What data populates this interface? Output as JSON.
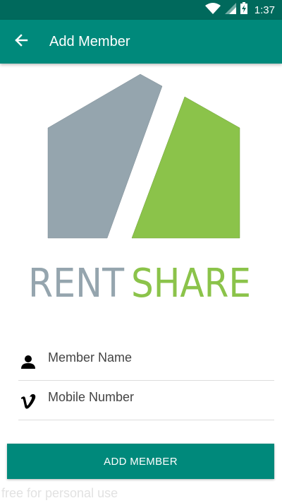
{
  "status_bar": {
    "time": "1:37",
    "icons": [
      "wifi-icon",
      "cell-signal-icon",
      "battery-charging-icon"
    ]
  },
  "app_bar": {
    "title": "Add Member",
    "back_icon": "arrow-left-icon"
  },
  "logo": {
    "word1": "RENT",
    "word2": "SHARE",
    "color_gray": "#95A5AE",
    "color_green": "#8BC34A"
  },
  "form": {
    "member_name": {
      "placeholder": "Member Name",
      "value": "",
      "icon": "person-icon"
    },
    "mobile_number": {
      "placeholder": "Mobile Number",
      "value": "",
      "icon": "vimeo-icon"
    }
  },
  "add_button": {
    "label": "ADD MEMBER"
  },
  "watermark": "free for personal use",
  "colors": {
    "primary": "#00897B",
    "primary_dark": "#00695C"
  }
}
